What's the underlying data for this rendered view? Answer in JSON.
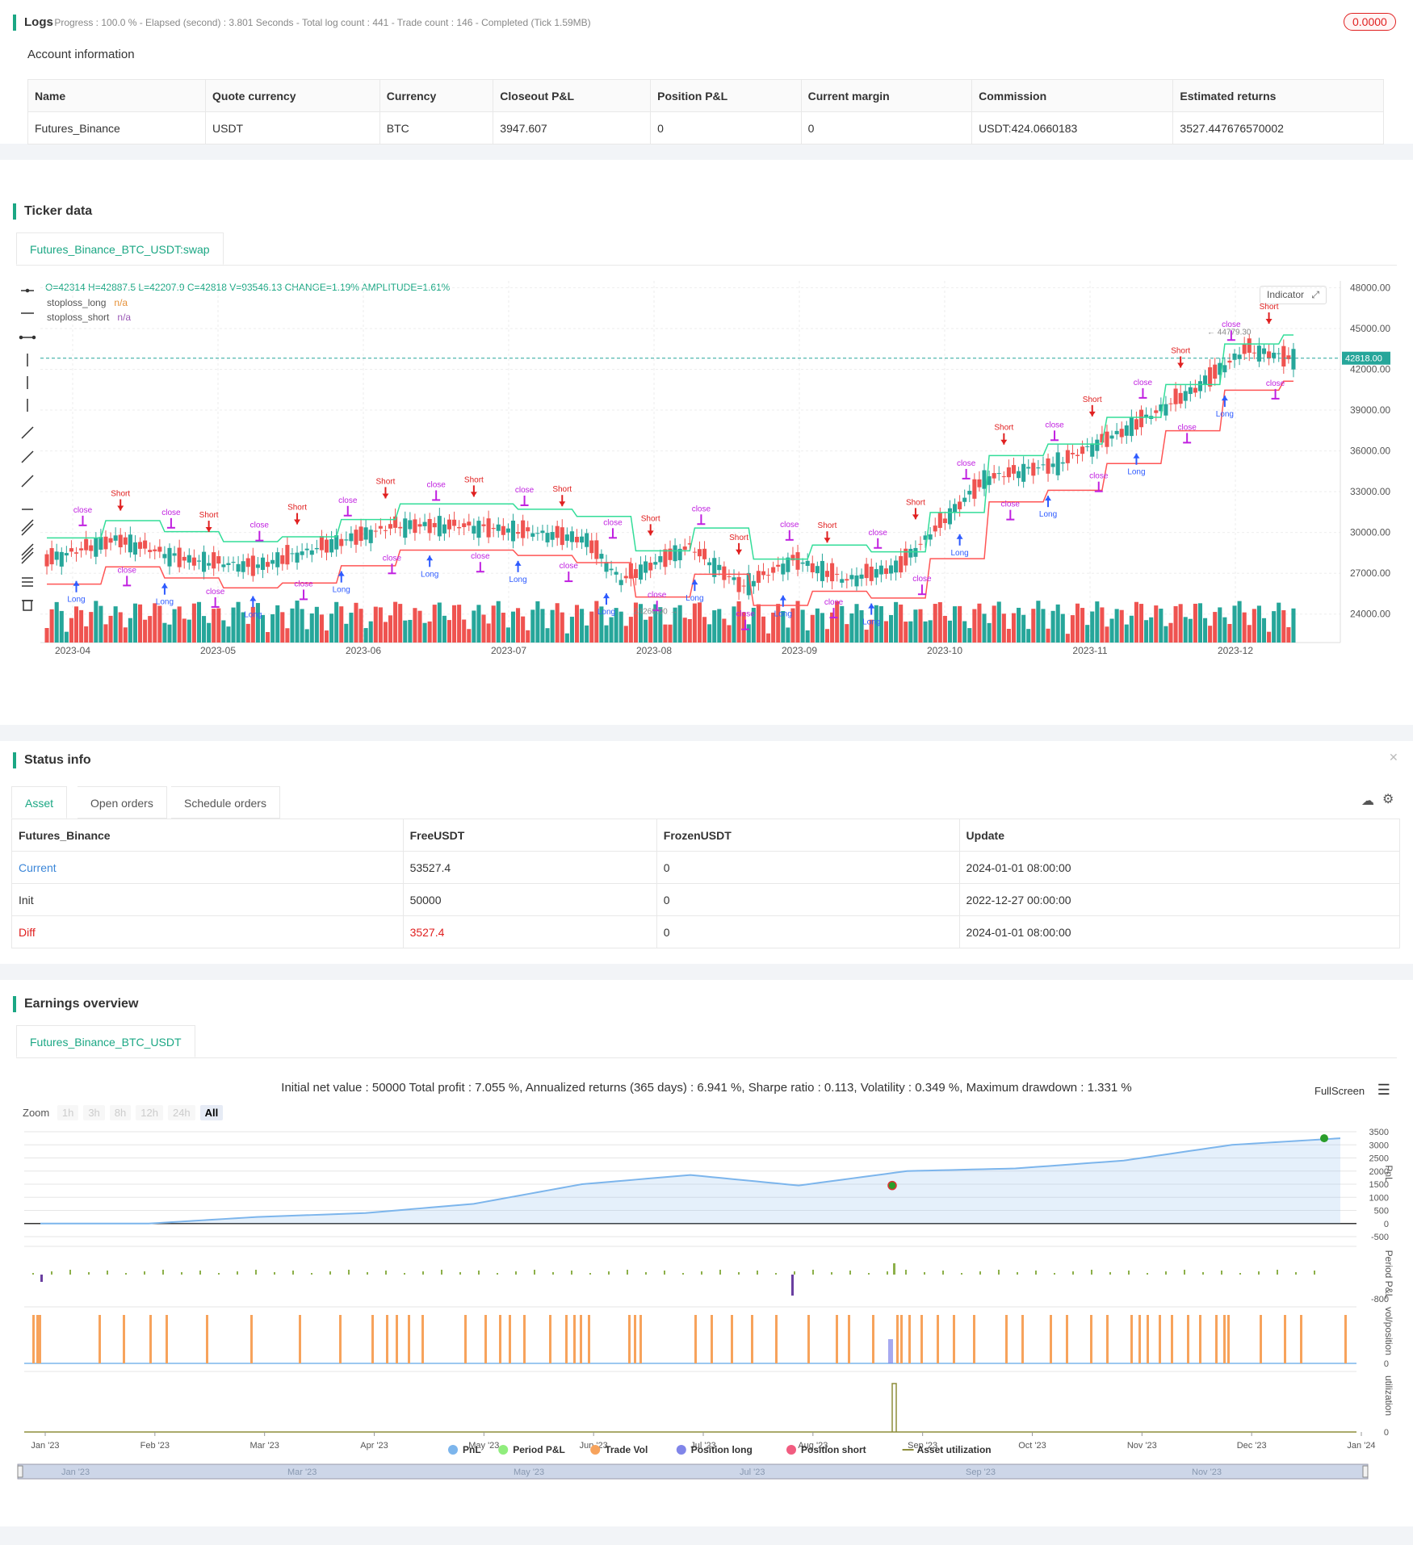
{
  "logs": {
    "title": "Logs",
    "progress": "- Progress : 100.0 % - Elapsed (second) : 3.801  Seconds - Total log count : 441 - Trade count : 146 - Completed (Tick 1.59MB)",
    "badge": "0.0000",
    "account_title": "Account information",
    "headers": [
      "Name",
      "Quote currency",
      "Currency",
      "Closeout P&L",
      "Position P&L",
      "Current margin",
      "Commission",
      "Estimated returns"
    ],
    "row": [
      "Futures_Binance",
      "USDT",
      "BTC",
      "3947.607",
      "0",
      "0",
      "USDT:424.0660183",
      "3527.447676570002"
    ]
  },
  "ticker": {
    "title": "Ticker data",
    "tab": "Futures_Binance_BTC_USDT:swap",
    "ohlc": "O=42314 H=42887.5 L=42207.9 C=42818 V=93546.13 CHANGE=1.19% AMPLITUDE=1.61%",
    "legend": [
      {
        "name": "stoploss_long",
        "value": "n/a",
        "color": "#e69138"
      },
      {
        "name": "stoploss_short",
        "value": "n/a",
        "color": "#9b59b6"
      }
    ],
    "indicator_btn": "Indicator",
    "price_label": "42818.00",
    "high_label": "44779.30",
    "low_label": "24260.00",
    "y_ticks": [
      "48000.00",
      "45000.00",
      "42000.00",
      "39000.00",
      "36000.00",
      "33000.00",
      "30000.00",
      "27000.00",
      "24000.00"
    ],
    "x_ticks": [
      "2023-04",
      "2023-05",
      "2023-06",
      "2023-07",
      "2023-08",
      "2023-09",
      "2023-10",
      "2023-11",
      "2023-12"
    ]
  },
  "status": {
    "title": "Status info",
    "tabs": [
      "Asset",
      "Open orders",
      "Schedule orders"
    ],
    "headers": [
      "Futures_Binance",
      "FreeUSDT",
      "FrozenUSDT",
      "Update"
    ],
    "rows": [
      [
        "Current",
        "53527.4",
        "0",
        "2024-01-01 08:00:00"
      ],
      [
        "Init",
        "50000",
        "0",
        "2022-12-27 00:00:00"
      ],
      [
        "Diff",
        "3527.4",
        "0",
        "2024-01-01 08:00:00"
      ]
    ]
  },
  "earnings": {
    "title": "Earnings overview",
    "tab": "Futures_Binance_BTC_USDT",
    "summary": "Initial net value : 50000 Total profit : 7.055 %, Annualized returns (365 days) : 6.941 %, Sharpe ratio : 0.113, Volatility : 0.349 %, Maximum drawdown : 1.331 %",
    "fullscreen": "FullScreen",
    "zoom_label": "Zoom",
    "zoom_options": [
      "1h",
      "3h",
      "8h",
      "12h",
      "24h",
      "All"
    ],
    "pnl_ticks": [
      "3500",
      "3000",
      "2500",
      "2000",
      "1500",
      "1000",
      "500",
      "0",
      "-500"
    ],
    "panel_labels": [
      "PnL",
      "Period P&L",
      "vol/position",
      "utilization"
    ],
    "period_tick": "-800",
    "zero": "0",
    "x_ticks": [
      "Jan '23",
      "Feb '23",
      "Mar '23",
      "Apr '23",
      "May '23",
      "Jun '23",
      "Jul '23",
      "Aug '23",
      "Sep '23",
      "Oct '23",
      "Nov '23",
      "Dec '23",
      "Jan '24"
    ],
    "legend": [
      {
        "name": "PnL",
        "color": "#7cb5ec"
      },
      {
        "name": "Period P&L",
        "color": "#90ed7d"
      },
      {
        "name": "Trade Vol",
        "color": "#f7a35c"
      },
      {
        "name": "Position long",
        "color": "#8085e9"
      },
      {
        "name": "Position short",
        "color": "#f15c80"
      },
      {
        "name": "Asset utilization",
        "color": "#8d8d3a"
      }
    ],
    "navigator_ticks": [
      "Jan '23",
      "Mar '23",
      "May '23",
      "Jul '23",
      "Sep '23",
      "Nov '23"
    ]
  },
  "chart_data": {
    "type": "line",
    "title": "",
    "ylabel": "PnL",
    "x": [
      "Jan '23",
      "Feb '23",
      "Mar '23",
      "Apr '23",
      "May '23",
      "Jun '23",
      "Jul '23",
      "Aug '23",
      "Sep '23",
      "Oct '23",
      "Nov '23",
      "Dec '23",
      "Jan '24"
    ],
    "series": [
      {
        "name": "PnL",
        "values": [
          0,
          0,
          250,
          400,
          750,
          1500,
          1850,
          1450,
          2000,
          2100,
          2400,
          3000,
          3250
        ]
      }
    ],
    "ylim": [
      -500,
      3500
    ]
  }
}
